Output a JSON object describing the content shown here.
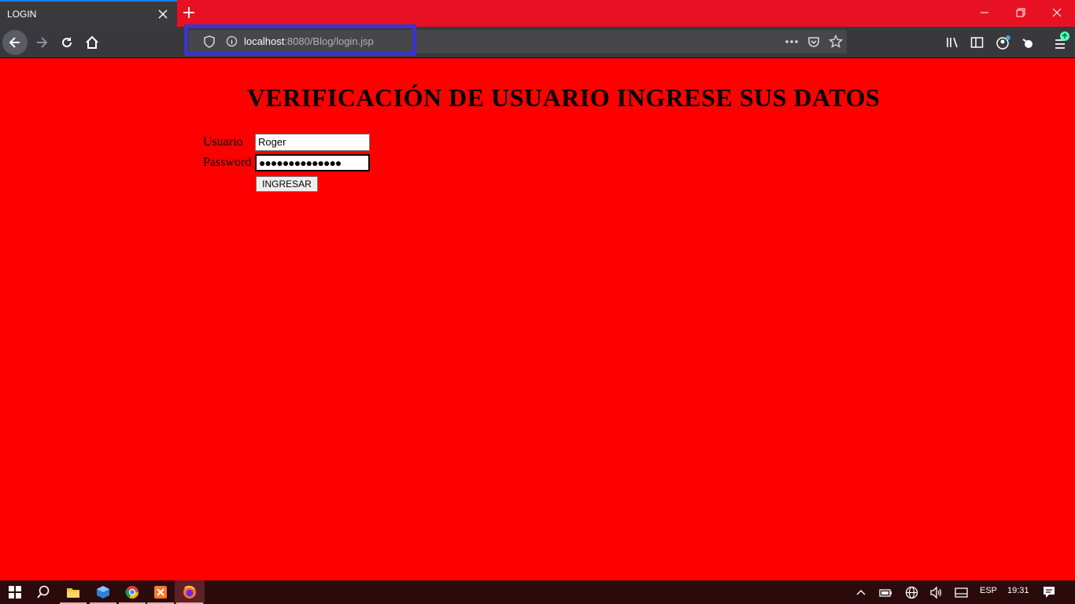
{
  "browser": {
    "tab_title": "LOGIN",
    "url_host": "localhost",
    "url_path": ":8080/Blog/login.jsp"
  },
  "page": {
    "heading": "VERIFICACIÓN DE USUARIO INGRESE SUS DATOS",
    "usuario_label": "Usuario",
    "usuario_value": "Roger",
    "password_label": "Password",
    "password_value": "●●●●●●●●●●●●●●",
    "submit_label": "INGRESAR",
    "background": "#ff0000"
  },
  "taskbar": {
    "language": "ESP",
    "time": "19:31",
    "apps": [
      "windows-start-icon",
      "search-icon",
      "file-explorer-icon",
      "virtualbox-icon",
      "chrome-icon",
      "xampp-icon",
      "firefox-icon"
    ]
  }
}
